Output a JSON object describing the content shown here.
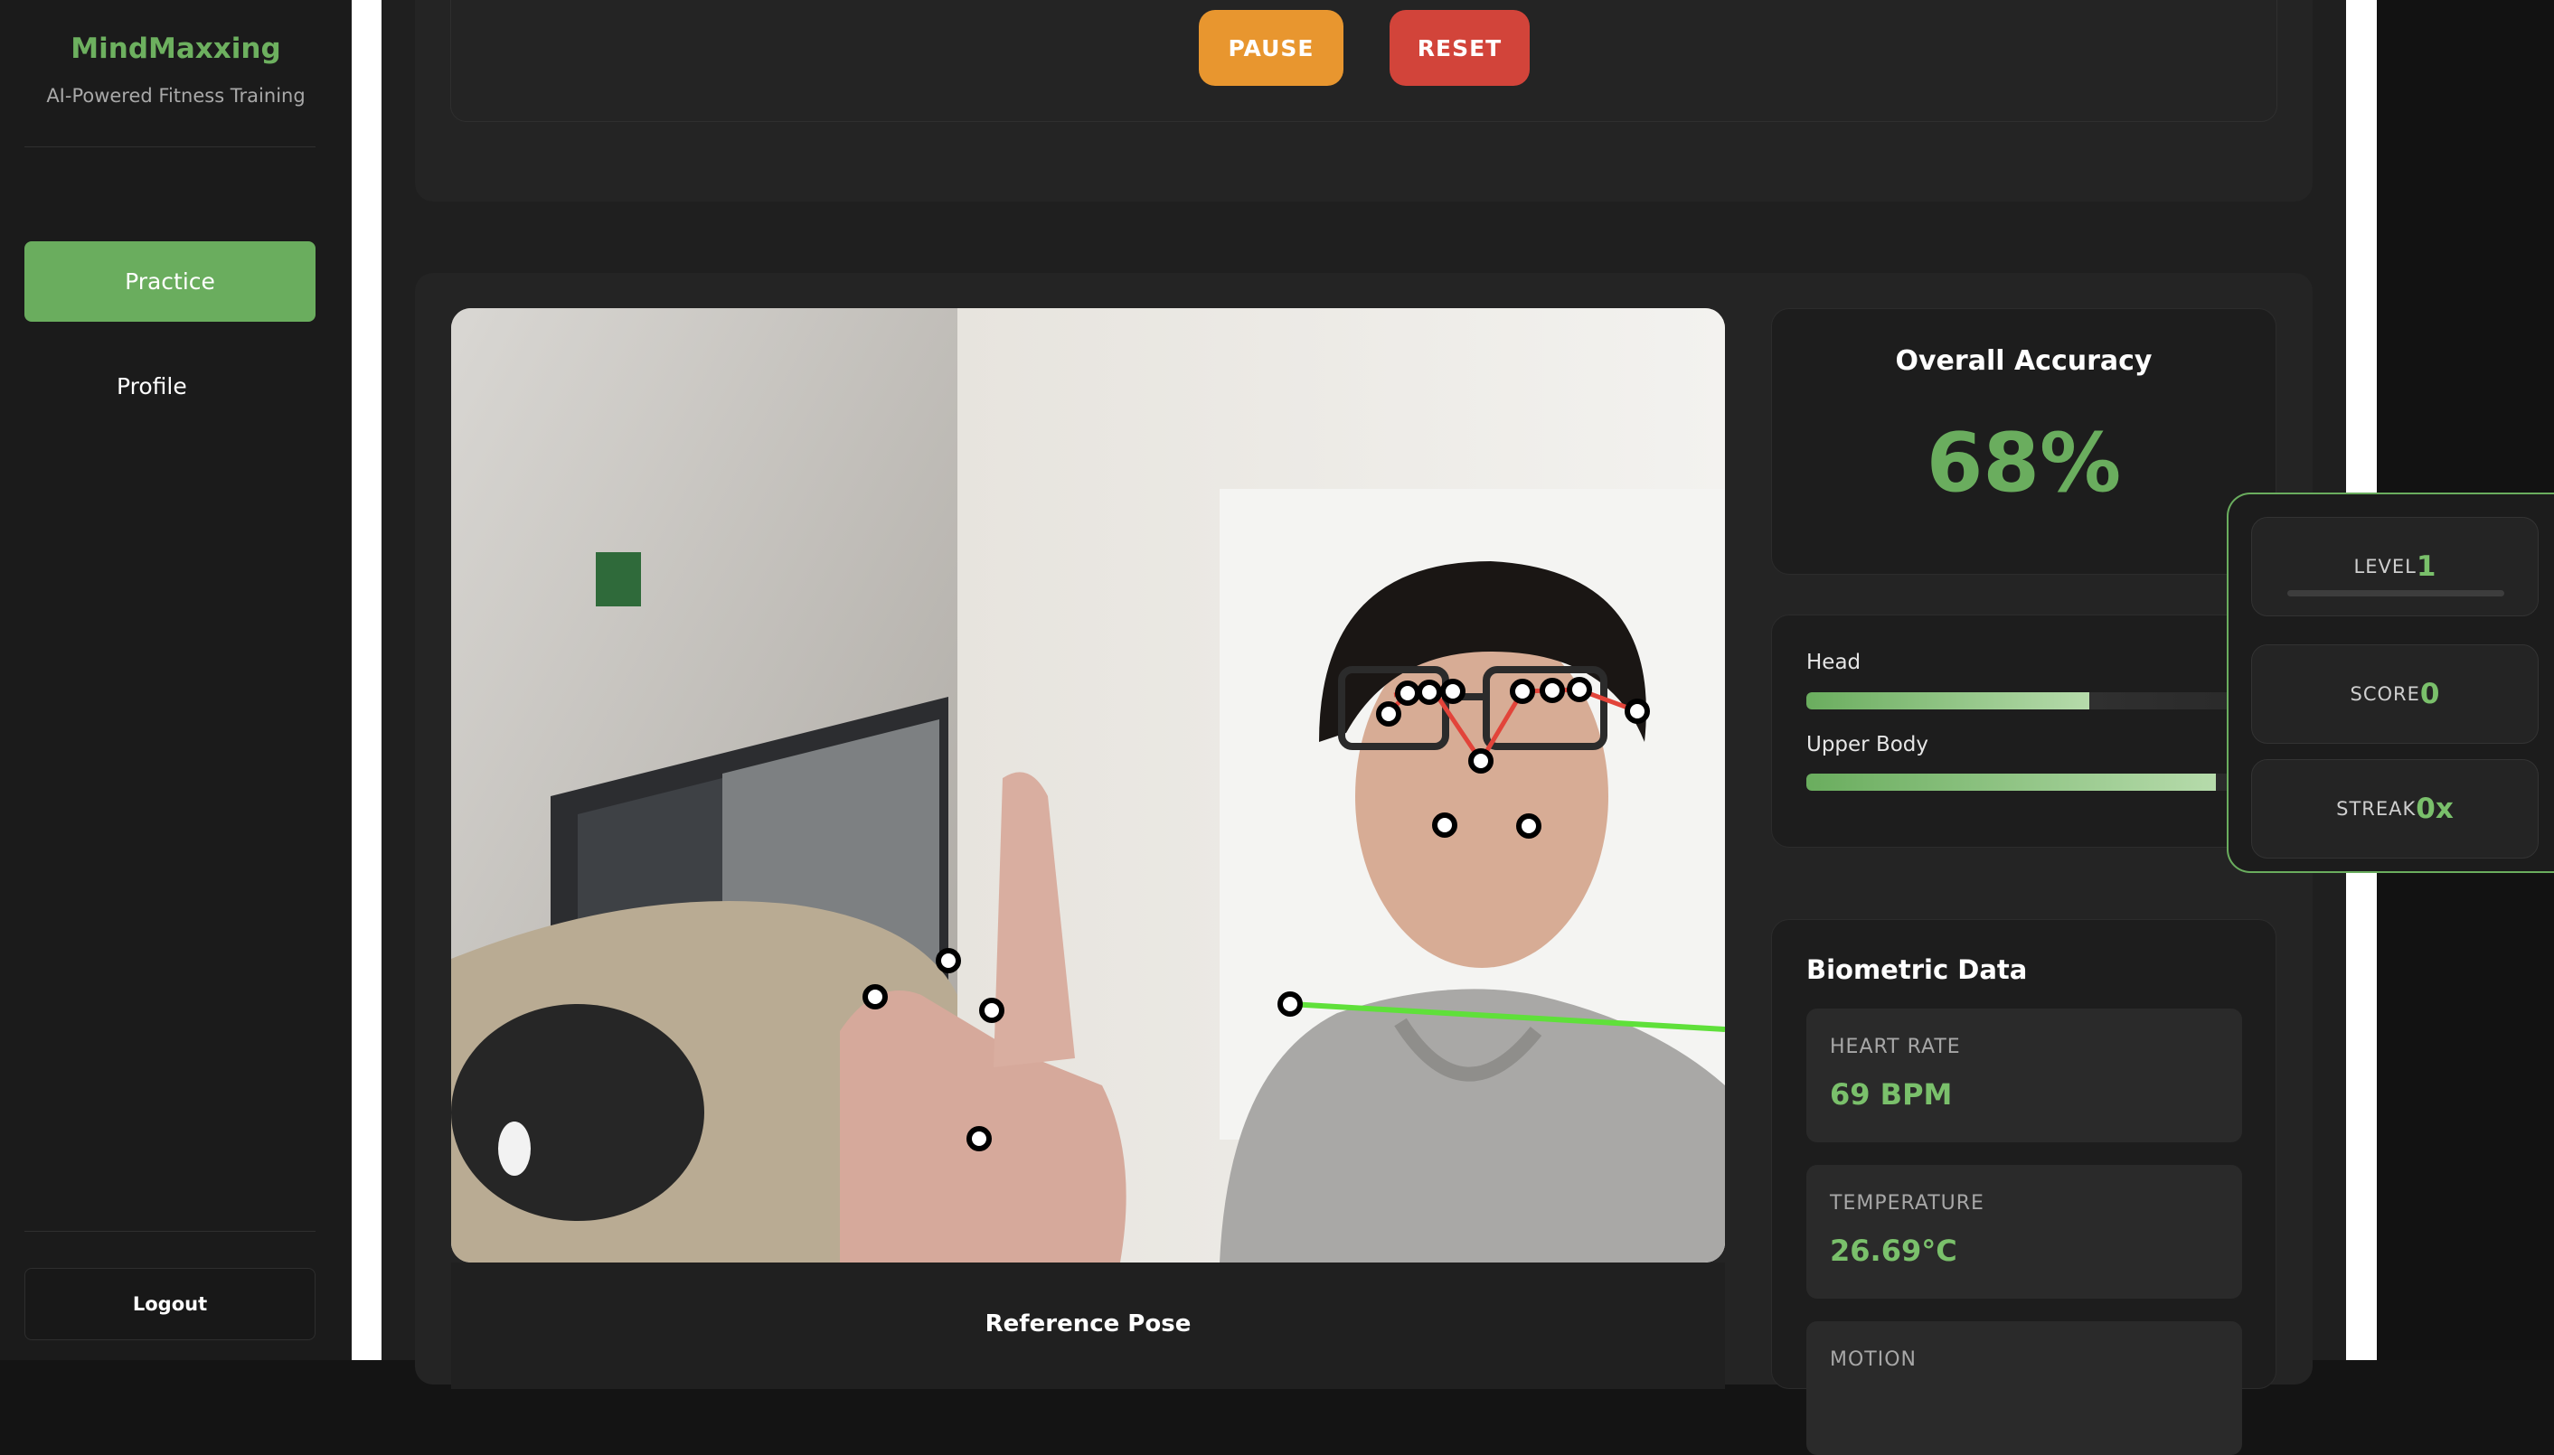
{
  "app": {
    "name": "MindMaxxing",
    "tagline": "AI-Powered Fitness Training"
  },
  "sidebar": {
    "items": [
      {
        "label": "Practice",
        "active": true
      },
      {
        "label": "Profile",
        "active": false
      }
    ],
    "logout_label": "Logout"
  },
  "controls": {
    "pause_label": "PAUSE",
    "reset_label": "RESET"
  },
  "practice": {
    "reference_label": "Reference Pose"
  },
  "accuracy": {
    "title": "Overall Accuracy",
    "value": "68%"
  },
  "body_parts": [
    {
      "label": "Head",
      "progress": 0.65
    },
    {
      "label": "Upper Body",
      "progress": 0.94
    }
  ],
  "biometric": {
    "title": "Biometric Data",
    "items": [
      {
        "label": "HEART RATE",
        "value": "69 BPM"
      },
      {
        "label": "TEMPERATURE",
        "value": "26.69°C"
      },
      {
        "label": "MOTION",
        "value": ""
      }
    ]
  },
  "stats": {
    "level_label": "LEVEL",
    "level_value": "1",
    "level_progress": 0.0,
    "score_label": "SCORE",
    "score_value": "0",
    "streak_label": "STREAK",
    "streak_value": "0x"
  },
  "colors": {
    "accent": "#6aad5e",
    "pause": "#e8962f",
    "reset": "#d2443a",
    "pose_line_red": "#e2443a",
    "pose_line_green": "#5fe03a"
  }
}
